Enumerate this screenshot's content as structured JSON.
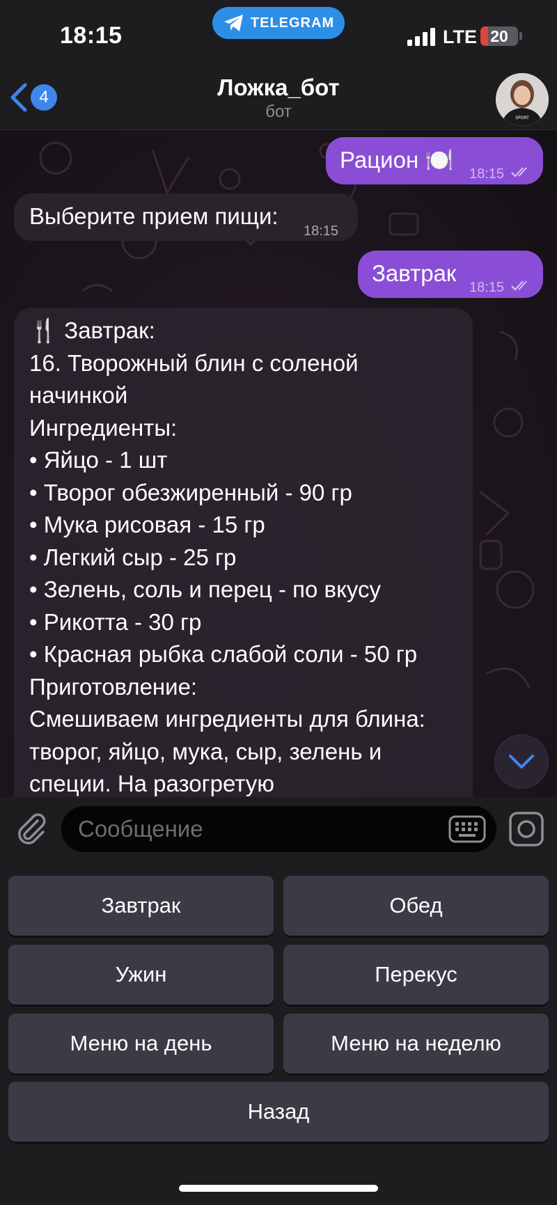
{
  "status_bar": {
    "time": "18:15",
    "app_pill": "TELEGRAM",
    "network": "LTE",
    "battery_level": "20",
    "battery_fraction": 0.2,
    "battery_color": "#e0443d"
  },
  "header": {
    "back_badge": "4",
    "title": "Ложка_бот",
    "subtitle": "бот"
  },
  "messages": [
    {
      "direction": "out",
      "text": "Рацион 🍽️",
      "time": "18:15"
    },
    {
      "direction": "in",
      "text": "Выберите прием пищи:",
      "time": "18:15"
    },
    {
      "direction": "out",
      "text": "Завтрак",
      "time": "18:15"
    }
  ],
  "recipe": {
    "lines": [
      "🍴 Завтрак:",
      "16. Творожный блин с соленой",
      "начинкой",
      "Ингредиенты:",
      "• Яйцо - 1 шт",
      "• Творог обезжиренный - 90 гр",
      "• Мука рисовая - 15 гр",
      "• Легкий сыр - 25 гр",
      "• Зелень, соль и перец - по вкусу",
      "• Рикотта - 30 гр",
      "• Красная рыбка слабой соли - 50 гр",
      "Приготовление:",
      "Смешиваем ингредиенты для блина:",
      "творог, яйцо, мука, сыр, зелень и",
      "специи. На разогретую"
    ]
  },
  "input": {
    "placeholder": "Сообщение"
  },
  "keyboard": {
    "buttons": [
      "Завтрак",
      "Обед",
      "Ужин",
      "Перекус",
      "Меню на день",
      "Меню на неделю",
      "Назад"
    ]
  },
  "colors": {
    "outgoing_bubble": "#8a4ed6",
    "incoming_bubble": "#2a232c",
    "accent": "#3e86ec",
    "telegram_blue": "#2d8ee8"
  }
}
